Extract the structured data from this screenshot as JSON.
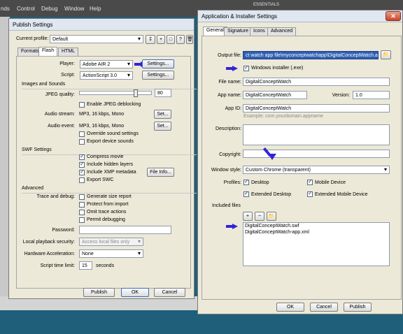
{
  "background_app": {
    "menu": [
      "nds",
      "Control",
      "Debug",
      "Window",
      "Help"
    ],
    "right_label": "ESSENTIALS"
  },
  "publish": {
    "title": "Publish Settings",
    "current_profile_label": "Current profile:",
    "current_profile": "Default",
    "tabs": [
      "Formats",
      "Flash",
      "HTML"
    ],
    "player_label": "Player:",
    "player": "Adobe AIR 2",
    "settings_btn": "Settings...",
    "script_label": "Script:",
    "script": "ActionScript 3.0",
    "images_section": "Images and Sounds",
    "jpeg_label": "JPEG quality:",
    "jpeg_value": "80",
    "jpeg_quality_fraction": 0.8,
    "jpeg_deblock": "Enable JPEG deblocking",
    "audio_stream_label": "Audio stream:",
    "audio_stream": "MP3, 16 kbps, Mono",
    "audio_event_label": "Audio event:",
    "audio_event": "MP3, 16 kbps, Mono",
    "set_btn": "Set...",
    "override_sound": "Override sound settings",
    "export_device": "Export device sounds",
    "swf_section": "SWF Settings",
    "compress": "Compress movie",
    "hidden_layers": "Include hidden layers",
    "xmp": "Include XMP metadata",
    "file_info_btn": "File Info...",
    "export_swc": "Export SWC",
    "advanced_section": "Advanced",
    "trace_label": "Trace and debug:",
    "size_report": "Generate size report",
    "protect_import": "Protect from import",
    "omit_trace": "Omit trace actions",
    "permit_debug": "Permit debugging",
    "password_label": "Password:",
    "local_playback_label": "Local playback security:",
    "local_playback": "Access local files only",
    "hw_accel_label": "Hardware Acceleration:",
    "hw_accel": "None",
    "script_time_label": "Script time limit:",
    "script_time_value": "15",
    "seconds": "seconds",
    "publish_btn": "Publish",
    "ok_btn": "OK",
    "cancel_btn": "Cancel"
  },
  "installer": {
    "title": "Application & Installer Settings",
    "tabs": [
      "General",
      "Signature",
      "Icons",
      "Advanced"
    ],
    "output_label": "Output file:",
    "output_value": "ct watch app file\\myconceptwatchapp\\DigitalConceptWatch.air",
    "windows_installer": "Windows installer (.exe)",
    "file_name_label": "File name:",
    "file_name": "DigitalConceptWatch",
    "app_name_label": "App name:",
    "app_name": "DigitalConceptWatch",
    "version_label": "Version:",
    "version": "1.0",
    "app_id_label": "App ID:",
    "app_id": "DigitalConceptWatch",
    "example": "Example: com.yourdomain.appname",
    "description_label": "Description:",
    "copyright_label": "Copyright:",
    "window_style_label": "Window style:",
    "window_style": "Custom Chrome (transparent)",
    "profiles_label": "Profiles:",
    "profile_desktop": "Desktop",
    "profile_mobile": "Mobile Device",
    "profile_ext_desktop": "Extended Desktop",
    "profile_ext_mobile": "Extended Mobile Device",
    "included_label": "Included files",
    "included_files": [
      "DigitalConceptWatch.swf",
      "DigitalConceptWatch-app.xml"
    ],
    "ok_btn": "OK",
    "cancel_btn": "Cancel",
    "publish_btn": "Publish"
  },
  "colors": {
    "annotation_arrow": "#3323d8",
    "selection": "#2f5fb3",
    "desktop_bg": "#1f5f7a"
  }
}
